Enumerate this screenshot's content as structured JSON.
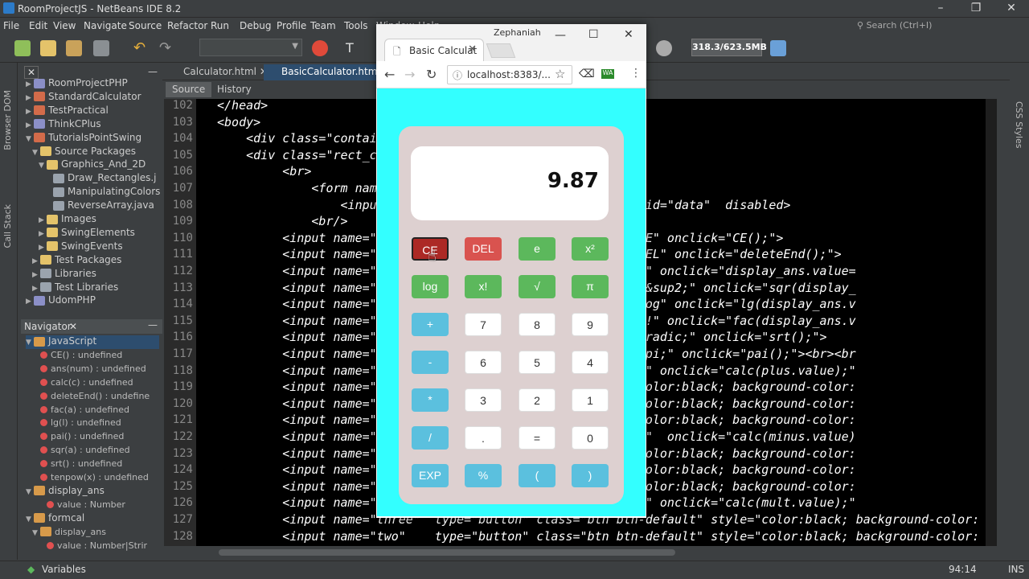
{
  "ide": {
    "title": "RoomProjectJS - NetBeans IDE 8.2",
    "menu": [
      "File",
      "Edit",
      "View",
      "Navigate",
      "Source",
      "Refactor",
      "Run",
      "Debug",
      "Profile",
      "Team",
      "Tools",
      "Window",
      "Help"
    ],
    "search_placeholder": "Search (Ctrl+I)",
    "memory": "318.3/623.5MB",
    "left_vtabs": [
      "Browser DOM",
      "Call Stack"
    ],
    "right_vtab": "CSS Styles",
    "project_tree": [
      {
        "label": "RoomProjectPHP",
        "indent": 0,
        "arrow": "▶",
        "icon": "php"
      },
      {
        "label": "StandardCalculator",
        "indent": 0,
        "arrow": "▶",
        "icon": "java"
      },
      {
        "label": "TestPractical",
        "indent": 0,
        "arrow": "▶",
        "icon": "java"
      },
      {
        "label": "ThinkCPlus",
        "indent": 0,
        "arrow": "▶",
        "icon": "php"
      },
      {
        "label": "TutorialsPointSwing",
        "indent": 0,
        "arrow": "▼",
        "icon": "java"
      },
      {
        "label": "Source Packages",
        "indent": 1,
        "arrow": "▼",
        "icon": "pkg"
      },
      {
        "label": "Graphics_And_2D",
        "indent": 2,
        "arrow": "▼",
        "icon": "pkg"
      },
      {
        "label": "Draw_Rectangles.j",
        "indent": 3,
        "arrow": "",
        "icon": "file"
      },
      {
        "label": "ManipulatingColors",
        "indent": 3,
        "arrow": "",
        "icon": "file"
      },
      {
        "label": "ReverseArray.java",
        "indent": 3,
        "arrow": "",
        "icon": "file"
      },
      {
        "label": "Images",
        "indent": 2,
        "arrow": "▶",
        "icon": "pkg"
      },
      {
        "label": "SwingElements",
        "indent": 2,
        "arrow": "▶",
        "icon": "pkg"
      },
      {
        "label": "SwingEvents",
        "indent": 2,
        "arrow": "▶",
        "icon": "pkg"
      },
      {
        "label": "Test Packages",
        "indent": 1,
        "arrow": "▶",
        "icon": "pkg"
      },
      {
        "label": "Libraries",
        "indent": 1,
        "arrow": "▶",
        "icon": "lib"
      },
      {
        "label": "Test Libraries",
        "indent": 1,
        "arrow": "▶",
        "icon": "lib"
      },
      {
        "label": "UdomPHP",
        "indent": 0,
        "arrow": "▶",
        "icon": "php"
      }
    ],
    "navigator": {
      "title": "Navigator",
      "items": [
        {
          "label": "JavaScript",
          "indent": 0,
          "arrow": "▼",
          "sel": true
        },
        {
          "label": "CE() : undefined",
          "indent": 1,
          "arrow": ""
        },
        {
          "label": "ans(num) : undefined",
          "indent": 1,
          "arrow": ""
        },
        {
          "label": "calc(c) : undefined",
          "indent": 1,
          "arrow": ""
        },
        {
          "label": "deleteEnd() : undefine",
          "indent": 1,
          "arrow": ""
        },
        {
          "label": "fac(a) : undefined",
          "indent": 1,
          "arrow": ""
        },
        {
          "label": "lg(l) : undefined",
          "indent": 1,
          "arrow": ""
        },
        {
          "label": "pai() : undefined",
          "indent": 1,
          "arrow": ""
        },
        {
          "label": "sqr(a) : undefined",
          "indent": 1,
          "arrow": ""
        },
        {
          "label": "srt() : undefined",
          "indent": 1,
          "arrow": ""
        },
        {
          "label": "tenpow(x) : undefined",
          "indent": 1,
          "arrow": ""
        },
        {
          "label": "display_ans",
          "indent": 0,
          "arrow": "▼"
        },
        {
          "label": "value : Number",
          "indent": 2,
          "arrow": ""
        },
        {
          "label": "formcal",
          "indent": 0,
          "arrow": "▼"
        },
        {
          "label": "display_ans",
          "indent": 1,
          "arrow": "▼"
        },
        {
          "label": "value : Number|Strir",
          "indent": 2,
          "arrow": ""
        }
      ]
    },
    "tabs": [
      "Calculator.html",
      "BasicCalculator.html"
    ],
    "source_tab": "Source",
    "history_tab": "History",
    "status": {
      "variables": "Variables",
      "position": "94:14",
      "mode": "INS"
    },
    "code_lines": [
      {
        "n": "102",
        "t": "</head>"
      },
      {
        "n": "103",
        "t": "<body>"
      },
      {
        "n": "104",
        "t": "    <div class=\"contai"
      },
      {
        "n": "105",
        "t": "    <div class=\"rect_c"
      },
      {
        "n": "106",
        "t": "         <br>"
      },
      {
        "n": "107",
        "t": "             <form name="
      },
      {
        "n": "108",
        "t": "                 <input                     \"form-control\" id=\"data\"  disabled>"
      },
      {
        "n": "109",
        "t": "             <br/>"
      },
      {
        "n": "110",
        "t": "         <input name=\"a                    anger\"  value=\"CE\" onclick=\"CE();\">"
      },
      {
        "n": "111",
        "t": "         <input name=\"D                    anger\"  value=\"DEL\" onclick=\"deleteEnd();\">"
      },
      {
        "n": "112",
        "t": "         <input name=\"1                    uccess\" value=\"e\" onclick=\"display_ans.value="
      },
      {
        "n": "113",
        "t": "         <input name=\"x                    uccess\" value=\"x&sup2;\" onclick=\"sqr(display_"
      },
      {
        "n": "114",
        "t": "         <input name=\"l                    uccess\" value=\"log\" onclick=\"lg(display_ans.v"
      },
      {
        "n": "115",
        "t": "         <input name=\"f                    uccess\" value=\"x!\" onclick=\"fac(display_ans.v"
      },
      {
        "n": "116",
        "t": "         <input name=\"s                    uccess\" value=\"&radic;\" onclick=\"srt();\">"
      },
      {
        "n": "117",
        "t": "         <input name=\"p                    uccess\" value=\"&pi;\" onclick=\"pai();\"><br><br"
      },
      {
        "n": "118",
        "t": "         <input name=\"p                    nfo\"    value=\"+\" onclick=\"calc(plus.value);\""
      },
      {
        "n": "119",
        "t": "         <input name=\"s                    efault\" style=\"color:black; background-color:"
      },
      {
        "n": "120",
        "t": "         <input name=\"e                    efault\" style=\"color:black; background-color:"
      },
      {
        "n": "121",
        "t": "         <input name=\"n                    efault\" style=\"color:black; background-color:"
      },
      {
        "n": "122",
        "t": "         <input name=\"m                    nfo\"    value=\"-\"  onclick=\"calc(minus.value)"
      },
      {
        "n": "123",
        "t": "         <input name=\"s                    efault\" style=\"color:black; background-color:"
      },
      {
        "n": "124",
        "t": "         <input name=\"f                    efault\" style=\"color:black; background-color:"
      },
      {
        "n": "125",
        "t": "         <input name=\"f                    efault\" style=\"color:black; background-color:"
      },
      {
        "n": "126",
        "t": "         <input name=\"m                    nfo\"    value=\"*\" onclick=\"calc(mult.value);\""
      },
      {
        "n": "127",
        "t": "         <input name=\"three\"  type=\"button\" class=\"btn btn-default\" style=\"color:black; background-color:"
      },
      {
        "n": "128",
        "t": "         <input name=\"two\"    type=\"button\" class=\"btn btn-default\" style=\"color:black; background-color:"
      }
    ]
  },
  "browser": {
    "user": "Zephaniah",
    "tab_title": "Basic Calculat",
    "url": "localhost:8383/...",
    "display_value": "9.87",
    "buttons": [
      {
        "label": "CE",
        "style": "danger pressed"
      },
      {
        "label": "DEL",
        "style": "danger"
      },
      {
        "label": "e",
        "style": "success"
      },
      {
        "label": "x²",
        "style": "success"
      },
      {
        "label": "log",
        "style": "success"
      },
      {
        "label": "x!",
        "style": "success"
      },
      {
        "label": "√",
        "style": "success"
      },
      {
        "label": "π",
        "style": "success"
      },
      {
        "label": "+",
        "style": "info"
      },
      {
        "label": "7",
        "style": "def"
      },
      {
        "label": "8",
        "style": "def"
      },
      {
        "label": "9",
        "style": "def"
      },
      {
        "label": "-",
        "style": "info"
      },
      {
        "label": "6",
        "style": "def"
      },
      {
        "label": "5",
        "style": "def"
      },
      {
        "label": "4",
        "style": "def"
      },
      {
        "label": "*",
        "style": "info"
      },
      {
        "label": "3",
        "style": "def"
      },
      {
        "label": "2",
        "style": "def"
      },
      {
        "label": "1",
        "style": "def"
      },
      {
        "label": "/",
        "style": "info"
      },
      {
        "label": ".",
        "style": "def"
      },
      {
        "label": "=",
        "style": "def"
      },
      {
        "label": "0",
        "style": "def"
      },
      {
        "label": "EXP",
        "style": "info"
      },
      {
        "label": "%",
        "style": "info"
      },
      {
        "label": "(",
        "style": "info"
      },
      {
        "label": ")",
        "style": "info"
      }
    ]
  }
}
